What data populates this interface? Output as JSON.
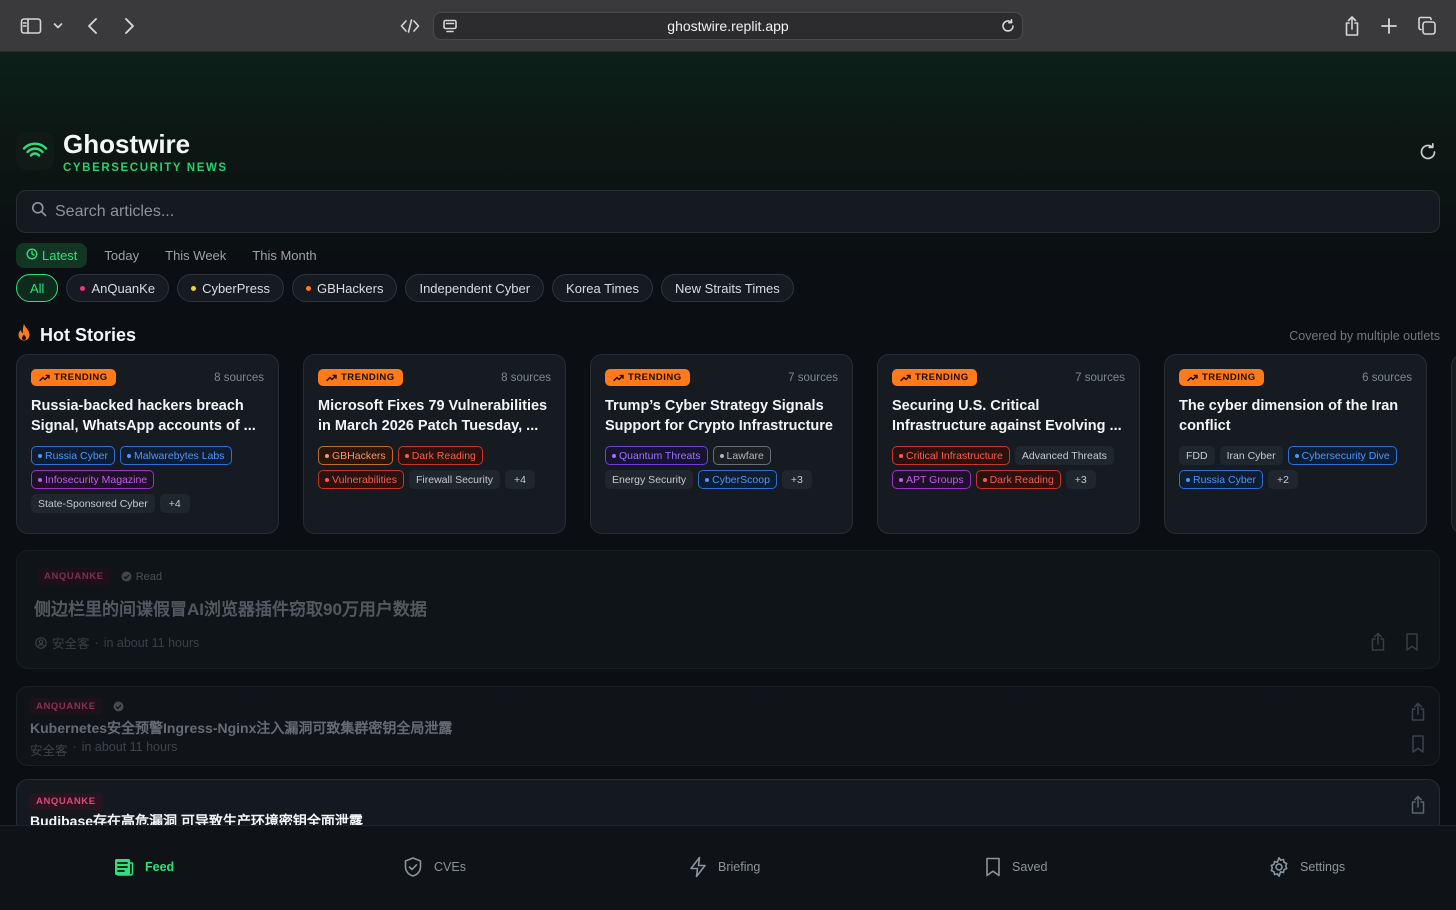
{
  "browser": {
    "url": "ghostwire.replit.app"
  },
  "header": {
    "title": "Ghostwire",
    "subtitle": "CYBERSECURITY NEWS"
  },
  "search": {
    "placeholder": "Search articles..."
  },
  "time_tabs": [
    {
      "label": "Latest",
      "active": true
    },
    {
      "label": "Today"
    },
    {
      "label": "This Week"
    },
    {
      "label": "This Month"
    }
  ],
  "source_filters": [
    {
      "label": "All",
      "active": true
    },
    {
      "label": "AnQuanKe",
      "dot": "#e83a73"
    },
    {
      "label": "CyberPress",
      "dot": "#f2d03a"
    },
    {
      "label": "GBHackers",
      "dot": "#ff7a2a"
    },
    {
      "label": "Independent Cyber"
    },
    {
      "label": "Korea Times"
    },
    {
      "label": "New Straits Times"
    }
  ],
  "hot": {
    "title": "Hot Stories",
    "note": "Covered by multiple outlets",
    "badge": "TRENDING",
    "cards": [
      {
        "sources": "8 sources",
        "title": "Russia-backed hackers breach Signal, WhatsApp accounts of ...",
        "tags": [
          {
            "t": "Russia Cyber",
            "c": "blue"
          },
          {
            "t": "Malwarebytes Labs",
            "c": "blue"
          },
          {
            "t": "Infosecurity Magazine",
            "c": "purple"
          },
          {
            "t": "State-Sponsored Cyber",
            "c": "plain"
          },
          {
            "t": "+4",
            "c": "more"
          }
        ]
      },
      {
        "sources": "8 sources",
        "title": "Microsoft Fixes 79 Vulnerabilities in March 2026 Patch Tuesday, ...",
        "tags": [
          {
            "t": "GBHackers",
            "c": "orange"
          },
          {
            "t": "Dark Reading",
            "c": "red"
          },
          {
            "t": "Vulnerabilities",
            "c": "red"
          },
          {
            "t": "Firewall Security",
            "c": "plain"
          },
          {
            "t": "+4",
            "c": "more"
          }
        ]
      },
      {
        "sources": "7 sources",
        "title": "Trump’s Cyber Strategy Signals Support for Crypto Infrastructure",
        "tags": [
          {
            "t": "Quantum Threats",
            "c": "violet"
          },
          {
            "t": "Lawfare",
            "c": "gray"
          },
          {
            "t": "Energy Security",
            "c": "plain"
          },
          {
            "t": "CyberScoop",
            "c": "blue"
          },
          {
            "t": "+3",
            "c": "more"
          }
        ]
      },
      {
        "sources": "7 sources",
        "title": "Securing U.S. Critical Infrastructure against Evolving ...",
        "tags": [
          {
            "t": "Critical Infrastructure",
            "c": "red"
          },
          {
            "t": "Advanced Threats",
            "c": "plain"
          },
          {
            "t": "APT Groups",
            "c": "purple"
          },
          {
            "t": "Dark Reading",
            "c": "red"
          },
          {
            "t": "+3",
            "c": "more"
          }
        ]
      },
      {
        "sources": "6 sources",
        "title": "The cyber dimension of the Iran conflict",
        "tags": [
          {
            "t": "FDD",
            "c": "plain"
          },
          {
            "t": "Iran Cyber",
            "c": "plain"
          },
          {
            "t": "Cybersecurity Dive",
            "c": "blue"
          },
          {
            "t": "Russia Cyber",
            "c": "blue"
          },
          {
            "t": "+2",
            "c": "more"
          }
        ]
      }
    ]
  },
  "articles": [
    {
      "source": "ANQUANKE",
      "read_label": "Read",
      "title": "侧边栏里的间谍假冒AI浏览器插件窃取90万用户数据",
      "author": "安全客",
      "time": "in about 11 hours"
    },
    {
      "source": "ANQUANKE",
      "title": "Kubernetes安全预警Ingress-Nginx注入漏洞可致集群密钥全局泄露",
      "author": "安全客",
      "time": "in about 11 hours"
    },
    {
      "source": "ANQUANKE",
      "title": "Budibase存在高危漏洞 可导致生产环境密钥全面泄露"
    }
  ],
  "nav": [
    {
      "label": "Feed",
      "active": true
    },
    {
      "label": "CVEs"
    },
    {
      "label": "Briefing"
    },
    {
      "label": "Saved"
    },
    {
      "label": "Settings"
    }
  ],
  "colors": {
    "accent": "#2fe07a",
    "trending": "#ff7a1a",
    "source_badge": "#d94a7a"
  }
}
